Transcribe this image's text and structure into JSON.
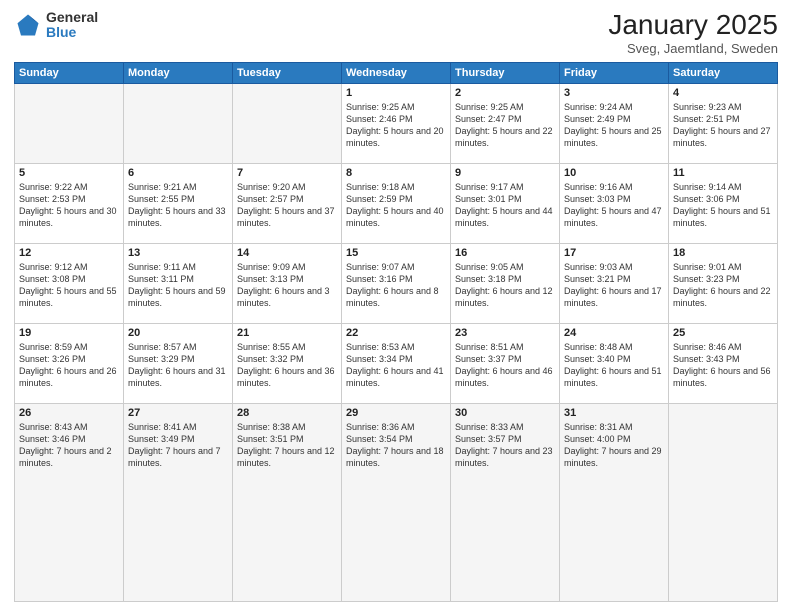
{
  "header": {
    "logo_general": "General",
    "logo_blue": "Blue",
    "title": "January 2025",
    "subtitle": "Sveg, Jaemtland, Sweden"
  },
  "weekdays": [
    "Sunday",
    "Monday",
    "Tuesday",
    "Wednesday",
    "Thursday",
    "Friday",
    "Saturday"
  ],
  "weeks": [
    [
      {
        "day": "",
        "sunrise": "",
        "sunset": "",
        "daylight": "",
        "empty": true
      },
      {
        "day": "",
        "sunrise": "",
        "sunset": "",
        "daylight": "",
        "empty": true
      },
      {
        "day": "",
        "sunrise": "",
        "sunset": "",
        "daylight": "",
        "empty": true
      },
      {
        "day": "1",
        "sunrise": "Sunrise: 9:25 AM",
        "sunset": "Sunset: 2:46 PM",
        "daylight": "Daylight: 5 hours and 20 minutes.",
        "empty": false
      },
      {
        "day": "2",
        "sunrise": "Sunrise: 9:25 AM",
        "sunset": "Sunset: 2:47 PM",
        "daylight": "Daylight: 5 hours and 22 minutes.",
        "empty": false
      },
      {
        "day": "3",
        "sunrise": "Sunrise: 9:24 AM",
        "sunset": "Sunset: 2:49 PM",
        "daylight": "Daylight: 5 hours and 25 minutes.",
        "empty": false
      },
      {
        "day": "4",
        "sunrise": "Sunrise: 9:23 AM",
        "sunset": "Sunset: 2:51 PM",
        "daylight": "Daylight: 5 hours and 27 minutes.",
        "empty": false
      }
    ],
    [
      {
        "day": "5",
        "sunrise": "Sunrise: 9:22 AM",
        "sunset": "Sunset: 2:53 PM",
        "daylight": "Daylight: 5 hours and 30 minutes.",
        "empty": false
      },
      {
        "day": "6",
        "sunrise": "Sunrise: 9:21 AM",
        "sunset": "Sunset: 2:55 PM",
        "daylight": "Daylight: 5 hours and 33 minutes.",
        "empty": false
      },
      {
        "day": "7",
        "sunrise": "Sunrise: 9:20 AM",
        "sunset": "Sunset: 2:57 PM",
        "daylight": "Daylight: 5 hours and 37 minutes.",
        "empty": false
      },
      {
        "day": "8",
        "sunrise": "Sunrise: 9:18 AM",
        "sunset": "Sunset: 2:59 PM",
        "daylight": "Daylight: 5 hours and 40 minutes.",
        "empty": false
      },
      {
        "day": "9",
        "sunrise": "Sunrise: 9:17 AM",
        "sunset": "Sunset: 3:01 PM",
        "daylight": "Daylight: 5 hours and 44 minutes.",
        "empty": false
      },
      {
        "day": "10",
        "sunrise": "Sunrise: 9:16 AM",
        "sunset": "Sunset: 3:03 PM",
        "daylight": "Daylight: 5 hours and 47 minutes.",
        "empty": false
      },
      {
        "day": "11",
        "sunrise": "Sunrise: 9:14 AM",
        "sunset": "Sunset: 3:06 PM",
        "daylight": "Daylight: 5 hours and 51 minutes.",
        "empty": false
      }
    ],
    [
      {
        "day": "12",
        "sunrise": "Sunrise: 9:12 AM",
        "sunset": "Sunset: 3:08 PM",
        "daylight": "Daylight: 5 hours and 55 minutes.",
        "empty": false
      },
      {
        "day": "13",
        "sunrise": "Sunrise: 9:11 AM",
        "sunset": "Sunset: 3:11 PM",
        "daylight": "Daylight: 5 hours and 59 minutes.",
        "empty": false
      },
      {
        "day": "14",
        "sunrise": "Sunrise: 9:09 AM",
        "sunset": "Sunset: 3:13 PM",
        "daylight": "Daylight: 6 hours and 3 minutes.",
        "empty": false
      },
      {
        "day": "15",
        "sunrise": "Sunrise: 9:07 AM",
        "sunset": "Sunset: 3:16 PM",
        "daylight": "Daylight: 6 hours and 8 minutes.",
        "empty": false
      },
      {
        "day": "16",
        "sunrise": "Sunrise: 9:05 AM",
        "sunset": "Sunset: 3:18 PM",
        "daylight": "Daylight: 6 hours and 12 minutes.",
        "empty": false
      },
      {
        "day": "17",
        "sunrise": "Sunrise: 9:03 AM",
        "sunset": "Sunset: 3:21 PM",
        "daylight": "Daylight: 6 hours and 17 minutes.",
        "empty": false
      },
      {
        "day": "18",
        "sunrise": "Sunrise: 9:01 AM",
        "sunset": "Sunset: 3:23 PM",
        "daylight": "Daylight: 6 hours and 22 minutes.",
        "empty": false
      }
    ],
    [
      {
        "day": "19",
        "sunrise": "Sunrise: 8:59 AM",
        "sunset": "Sunset: 3:26 PM",
        "daylight": "Daylight: 6 hours and 26 minutes.",
        "empty": false
      },
      {
        "day": "20",
        "sunrise": "Sunrise: 8:57 AM",
        "sunset": "Sunset: 3:29 PM",
        "daylight": "Daylight: 6 hours and 31 minutes.",
        "empty": false
      },
      {
        "day": "21",
        "sunrise": "Sunrise: 8:55 AM",
        "sunset": "Sunset: 3:32 PM",
        "daylight": "Daylight: 6 hours and 36 minutes.",
        "empty": false
      },
      {
        "day": "22",
        "sunrise": "Sunrise: 8:53 AM",
        "sunset": "Sunset: 3:34 PM",
        "daylight": "Daylight: 6 hours and 41 minutes.",
        "empty": false
      },
      {
        "day": "23",
        "sunrise": "Sunrise: 8:51 AM",
        "sunset": "Sunset: 3:37 PM",
        "daylight": "Daylight: 6 hours and 46 minutes.",
        "empty": false
      },
      {
        "day": "24",
        "sunrise": "Sunrise: 8:48 AM",
        "sunset": "Sunset: 3:40 PM",
        "daylight": "Daylight: 6 hours and 51 minutes.",
        "empty": false
      },
      {
        "day": "25",
        "sunrise": "Sunrise: 8:46 AM",
        "sunset": "Sunset: 3:43 PM",
        "daylight": "Daylight: 6 hours and 56 minutes.",
        "empty": false
      }
    ],
    [
      {
        "day": "26",
        "sunrise": "Sunrise: 8:43 AM",
        "sunset": "Sunset: 3:46 PM",
        "daylight": "Daylight: 7 hours and 2 minutes.",
        "empty": false,
        "last": true
      },
      {
        "day": "27",
        "sunrise": "Sunrise: 8:41 AM",
        "sunset": "Sunset: 3:49 PM",
        "daylight": "Daylight: 7 hours and 7 minutes.",
        "empty": false,
        "last": true
      },
      {
        "day": "28",
        "sunrise": "Sunrise: 8:38 AM",
        "sunset": "Sunset: 3:51 PM",
        "daylight": "Daylight: 7 hours and 12 minutes.",
        "empty": false,
        "last": true
      },
      {
        "day": "29",
        "sunrise": "Sunrise: 8:36 AM",
        "sunset": "Sunset: 3:54 PM",
        "daylight": "Daylight: 7 hours and 18 minutes.",
        "empty": false,
        "last": true
      },
      {
        "day": "30",
        "sunrise": "Sunrise: 8:33 AM",
        "sunset": "Sunset: 3:57 PM",
        "daylight": "Daylight: 7 hours and 23 minutes.",
        "empty": false,
        "last": true
      },
      {
        "day": "31",
        "sunrise": "Sunrise: 8:31 AM",
        "sunset": "Sunset: 4:00 PM",
        "daylight": "Daylight: 7 hours and 29 minutes.",
        "empty": false,
        "last": true
      },
      {
        "day": "",
        "sunrise": "",
        "sunset": "",
        "daylight": "",
        "empty": true,
        "last": true
      }
    ]
  ]
}
